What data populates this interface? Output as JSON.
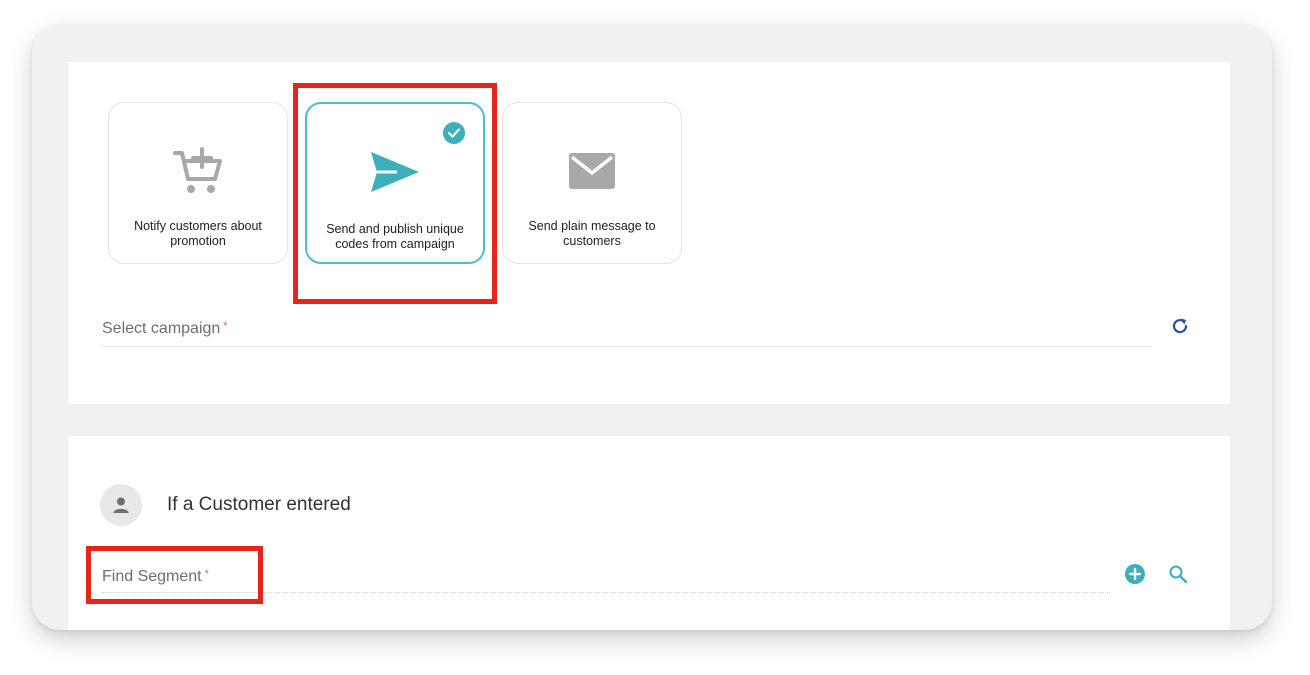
{
  "action_cards": [
    {
      "label": "Notify customers about promotion",
      "icon": "cart-plus-icon",
      "selected": false
    },
    {
      "label": "Send and publish unique codes from campaign",
      "icon": "send-icon",
      "selected": true
    },
    {
      "label": "Send plain message to customers",
      "icon": "envelope-icon",
      "selected": false
    }
  ],
  "campaign_field": {
    "label": "Select campaign",
    "required_mark": "*",
    "action_icon": "refresh-icon"
  },
  "trigger_section": {
    "title": "If a Customer entered",
    "icon": "person-icon"
  },
  "segment_field": {
    "label": "Find Segment",
    "required_mark": "*",
    "action_icons": [
      "add-circle-icon",
      "search-icon"
    ]
  },
  "colors": {
    "accent": "#3dafbb",
    "selected_border": "#4cbfca",
    "highlight": "#e5251b",
    "refresh": "#2b4aa0"
  }
}
